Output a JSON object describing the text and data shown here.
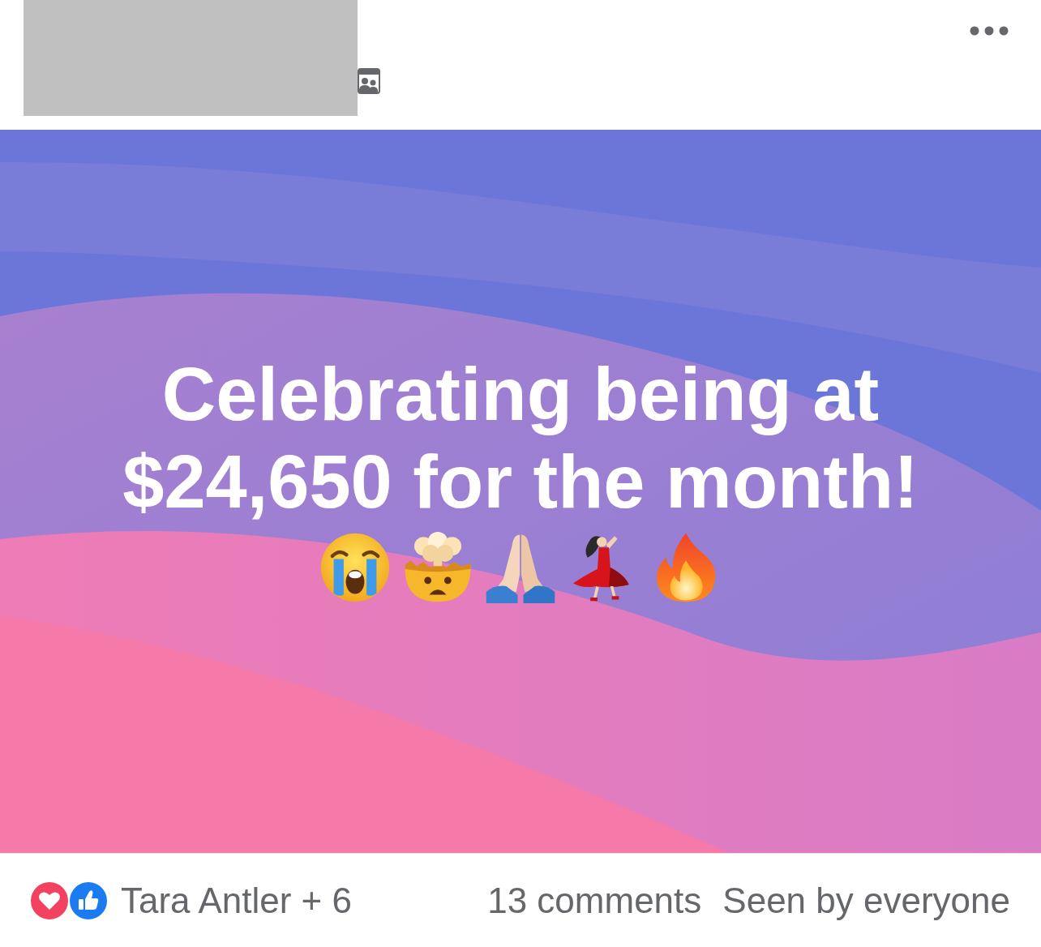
{
  "post": {
    "text": "Celebrating being at $24,650 for the month!",
    "emojis": [
      {
        "kind": "crying"
      },
      {
        "kind": "exploding-head"
      },
      {
        "kind": "folded-hands"
      },
      {
        "kind": "dancer"
      },
      {
        "kind": "fire"
      }
    ]
  },
  "footer": {
    "reactions": [
      {
        "kind": "love"
      },
      {
        "kind": "like"
      }
    ],
    "reacted_by": "Tara Antler + 6",
    "comments": "13 comments",
    "seen": "Seen by everyone"
  }
}
